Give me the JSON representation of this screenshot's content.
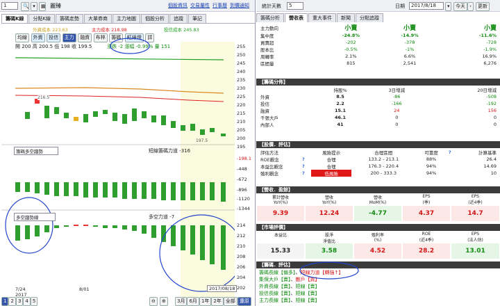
{
  "left": {
    "toolbar": {
      "code": "1",
      "name": "麗臻",
      "links": [
        "個股資訊",
        "交易屬性",
        "行事曆",
        "到價通知"
      ]
    },
    "tabs": [
      "籌碼K線",
      "分點K線",
      "籌碼走勢",
      "大單券商",
      "主力地圖",
      "個股分析",
      "追蹤",
      "筆記"
    ],
    "legend": [
      {
        "t": "外資成本 223.63",
        "c": "#c8a020"
      },
      {
        "t": "主力成本 218.98",
        "c": "#e02020"
      },
      {
        "t": "投信成本 245.83",
        "c": "#22a022"
      }
    ],
    "chips": [
      "均線",
      "外資",
      "投信",
      "主力",
      "融資",
      "布林",
      "籌碼",
      "紅綠燈",
      "詳"
    ],
    "ohlc": "開 200  高 200.5  低 198  收 199.5",
    "change": "漲跌 -2  漲幅 -0.99%  量 151",
    "price_axis": [
      "255",
      "250",
      "245",
      "240",
      "235",
      "230",
      "225",
      "220",
      "215",
      "210",
      "205",
      "200",
      "195"
    ],
    "label_high": "216.5",
    "label_low": "197.5",
    "ind1_select": "籌碼多空趨勢",
    "ind1_title": "短線籌碼力道 -316",
    "ind1_value": "-198.1",
    "ind1_axis": [
      "-448",
      "-672",
      "-896",
      "-1120",
      "-1344"
    ],
    "ind2_select": "多空趨勢線",
    "ind2_title": "多空力道 -7",
    "ind2_axis": [
      "214",
      "212",
      "210",
      "208",
      "206",
      "204",
      "202"
    ],
    "dates": [
      "7/24",
      "8/01"
    ],
    "year": "2017",
    "end_date": "2017/08/18",
    "pages": [
      "1",
      "2",
      "3",
      "4",
      "5"
    ],
    "periods": [
      "3月",
      "6月",
      "1年",
      "2年",
      "全部",
      "還原"
    ]
  },
  "right": {
    "toolbar": {
      "label": "統計天數",
      "days": "5",
      "date_label": "日期",
      "date": "2017/8/18",
      "today": "今天",
      "refresh": "更新"
    },
    "tabs": [
      "籌碼分析",
      "營收表",
      "重大事件",
      "新聞",
      "分點追蹤"
    ],
    "top": {
      "cols": [
        "",
        "小賣",
        "小賣",
        "小賣"
      ],
      "rows": [
        [
          "主力動向",
          "",
          "",
          ""
        ],
        [
          "集中度",
          "-24.8%",
          "-14.9%",
          "-11.6%"
        ],
        [
          "買賣超",
          "-202",
          "-378",
          "-728"
        ],
        [
          "股本比",
          "-0.5%",
          "-1%",
          "-1.9%"
        ],
        [
          "周轉率",
          "2.1%",
          "6.6%",
          "16.9%"
        ],
        [
          "區間量",
          "815",
          "2,541",
          "6,276"
        ]
      ]
    },
    "dist": {
      "title": "【籌碼分佈】",
      "head": [
        "",
        "持股%",
        "3日增減",
        "20日增減"
      ],
      "rows": [
        [
          "外資",
          "8.5",
          "-86",
          "-508"
        ],
        [
          "投信",
          "2.2",
          "-166",
          "-192"
        ],
        [
          "融資",
          "15.1",
          "24",
          "156"
        ],
        [
          "千張大戶",
          "46.1",
          "0",
          "0"
        ],
        [
          "內部人",
          "41",
          "0",
          "0"
        ]
      ]
    },
    "val": {
      "title": "【股價．評估】",
      "head": [
        "評估方法",
        "",
        "風險提示",
        "合理區間",
        "可靠度",
        "?",
        "計算基準"
      ],
      "rows": [
        [
          "ROE觀念",
          "?",
          "合理",
          "133.2 - 213.1",
          "88%",
          "",
          "26.4"
        ],
        [
          "本益比觀念",
          "?",
          "合理",
          "176.3 - 220.4",
          "94%",
          "",
          "14.69"
        ],
        [
          "殖利觀念",
          "?",
          "低風險",
          "200 - 333.3",
          "94%",
          "",
          "10"
        ]
      ]
    },
    "rev": {
      "title": "【營收．盈餘】",
      "head": [
        "累計營收\nYoY(%)",
        "營收\nYoY(%)",
        "營收\nMoM(%)",
        "EPS\n(季)",
        "EPS\n(近4季)"
      ],
      "vals": [
        "9.39",
        "12.24",
        "-4.77",
        "4.37",
        "14.7"
      ]
    },
    "mkt": {
      "title": "【市場評價】",
      "head": [
        "本益比",
        "股淨\n淨值比",
        "殖利率\n(%)",
        "ROE\n(近4季)",
        "EPS\n(法人估)"
      ],
      "vals": [
        "15.33",
        "3.58",
        "4.52",
        "28.2",
        "13.01"
      ]
    },
    "chip": {
      "title": "【籌碼．評估】",
      "lines": [
        [
          "籌碼長線【偏多】",
          "、",
          "短線力道【轉強↑】"
        ],
        [
          "集保大戶【賣】",
          "、",
          "散戶【買】"
        ],
        [
          "外資長線【賣】",
          "、",
          "短線【賣】"
        ],
        [
          "投信長線【賣】",
          "、",
          "短線【賣】"
        ],
        [
          "主力長線【賣】",
          "、",
          "短線【賣】"
        ]
      ]
    }
  }
}
